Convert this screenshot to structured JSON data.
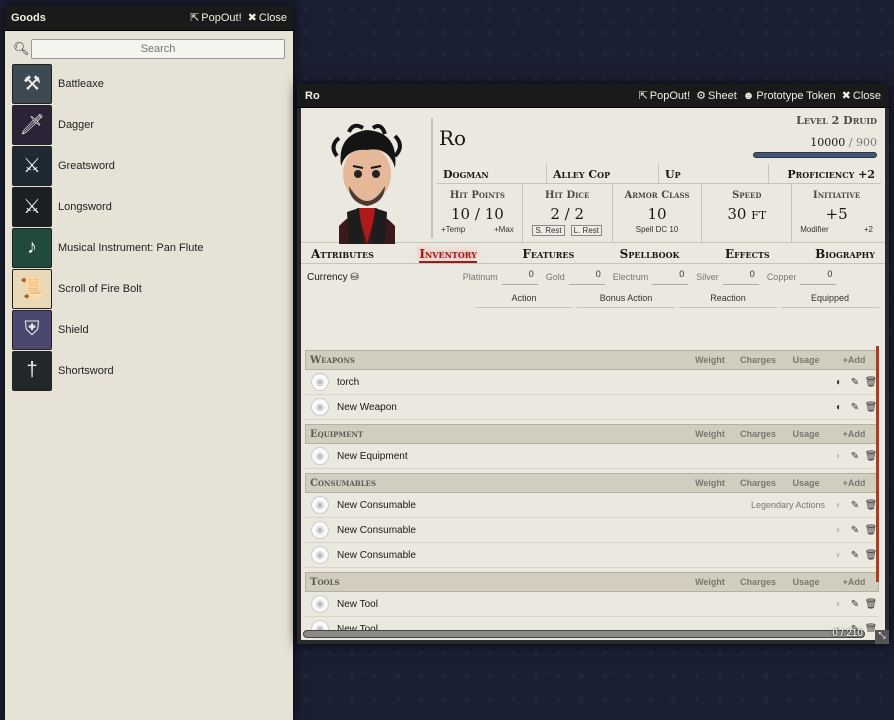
{
  "goods": {
    "title": "Goods",
    "popout": "PopOut!",
    "close": "Close",
    "search_placeholder": "Search",
    "items": [
      {
        "label": "Battleaxe",
        "icon": "axe-icon",
        "glyph": "⚒",
        "bg": "#3d4a52"
      },
      {
        "label": "Dagger",
        "icon": "dagger-icon",
        "glyph": "🗡",
        "bg": "#2a2436"
      },
      {
        "label": "Greatsword",
        "icon": "greatsword-icon",
        "glyph": "⚔",
        "bg": "#1e2a33"
      },
      {
        "label": "Longsword",
        "icon": "longsword-icon",
        "glyph": "⚔",
        "bg": "#1a1f24"
      },
      {
        "label": "Musical Instrument: Pan Flute",
        "icon": "pan-flute-icon",
        "glyph": "♪",
        "bg": "#1f4a3c"
      },
      {
        "label": "Scroll of Fire Bolt",
        "icon": "scroll-icon",
        "glyph": "📜",
        "bg": "#e9d9b8"
      },
      {
        "label": "Shield",
        "icon": "shield-icon",
        "glyph": "⛨",
        "bg": "#4b4870"
      },
      {
        "label": "Shortsword",
        "icon": "shortsword-icon",
        "glyph": "†",
        "bg": "#22282a"
      }
    ]
  },
  "sheet": {
    "title": "Ro",
    "popout": "PopOut!",
    "sheet_btn": "Sheet",
    "token_btn": "Prototype Token",
    "close": "Close",
    "name": "Ro",
    "level": "Level 2 Druid",
    "xp_value": "10000",
    "xp_sep": "/",
    "xp_max": "900",
    "summary": {
      "race": "Dogman",
      "background": "Alley Cop",
      "alignment": "Up",
      "proficiency": "Proficiency +2"
    },
    "attributes": {
      "hp_label": "Hit Points",
      "hp_value": "10",
      "hp_sep": "/",
      "hp_max": "10",
      "hp_temp": "+Temp",
      "hp_tmax": "+Max",
      "hd_label": "Hit Dice",
      "hd_value": "2 / 2",
      "s_rest": "S. Rest",
      "l_rest": "L. Rest",
      "ac_label": "Armor Class",
      "ac_value": "10",
      "ac_sub": "Spell DC 10",
      "speed_label": "Speed",
      "speed_value": "30 ft",
      "init_label": "Initiative",
      "init_value": "+5",
      "init_mod_label": "Modifier",
      "init_mod": "+2"
    },
    "tabs": [
      "Attributes",
      "Inventory",
      "Features",
      "Spellbook",
      "Effects",
      "Biography"
    ],
    "currency": {
      "label": "Currency",
      "coins": [
        {
          "name": "Platinum",
          "value": "0"
        },
        {
          "name": "Gold",
          "value": "0"
        },
        {
          "name": "Electrum",
          "value": "0"
        },
        {
          "name": "Silver",
          "value": "0"
        },
        {
          "name": "Copper",
          "value": "0"
        }
      ]
    },
    "actions": [
      "Action",
      "Bonus Action",
      "Reaction",
      "Equipped"
    ],
    "columns": {
      "weight": "Weight",
      "charges": "Charges",
      "usage": "Usage",
      "add": "Add"
    },
    "sections": {
      "weapons": {
        "name": "Weapons",
        "items": [
          "torch",
          "New Weapon"
        ]
      },
      "equipment": {
        "name": "Equipment",
        "items": [
          "New Equipment"
        ]
      },
      "consumables": {
        "name": "Consumables",
        "items": [
          "New Consumable",
          "New Consumable",
          "New Consumable"
        ],
        "legendary": "Legendary Actions"
      },
      "tools": {
        "name": "Tools",
        "items": [
          "New Tool",
          "New Tool"
        ]
      }
    },
    "encumbrance": "0 / 210"
  }
}
